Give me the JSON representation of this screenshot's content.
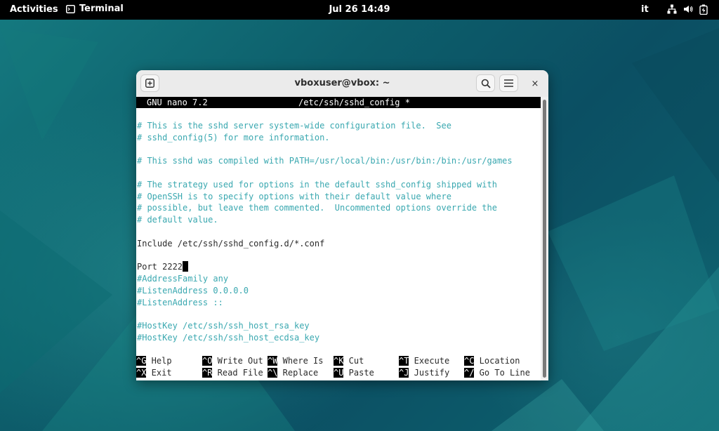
{
  "topbar": {
    "activities": "Activities",
    "app_name": "Terminal",
    "clock": "Jul 26  14:49",
    "language": "it",
    "icons": [
      "network-icon",
      "volume-icon",
      "battery-icon"
    ]
  },
  "window": {
    "title": "vboxuser@vbox: ~",
    "new_tab_icon": "new-tab-icon",
    "search_icon": "search-icon",
    "menu_icon": "hamburger-menu-icon",
    "close_label": "×"
  },
  "nano": {
    "version": "GNU nano 7.2",
    "filename": "/etc/ssh/sshd_config *",
    "lines": [
      {
        "text": "",
        "type": "normal"
      },
      {
        "text": "# This is the sshd server system-wide configuration file.  See",
        "type": "comment"
      },
      {
        "text": "# sshd_config(5) for more information.",
        "type": "comment"
      },
      {
        "text": "",
        "type": "normal"
      },
      {
        "text": "# This sshd was compiled with PATH=/usr/local/bin:/usr/bin:/bin:/usr/games",
        "type": "comment"
      },
      {
        "text": "",
        "type": "normal"
      },
      {
        "text": "# The strategy used for options in the default sshd_config shipped with",
        "type": "comment"
      },
      {
        "text": "# OpenSSH is to specify options with their default value where",
        "type": "comment"
      },
      {
        "text": "# possible, but leave them commented.  Uncommented options override the",
        "type": "comment"
      },
      {
        "text": "# default value.",
        "type": "comment"
      },
      {
        "text": "",
        "type": "normal"
      },
      {
        "text": "Include /etc/ssh/sshd_config.d/*.conf",
        "type": "normal"
      },
      {
        "text": "",
        "type": "normal"
      },
      {
        "text": "Port 2222",
        "type": "normal",
        "cursor": true
      },
      {
        "text": "#AddressFamily any",
        "type": "comment"
      },
      {
        "text": "#ListenAddress 0.0.0.0",
        "type": "comment"
      },
      {
        "text": "#ListenAddress ::",
        "type": "comment"
      },
      {
        "text": "",
        "type": "normal"
      },
      {
        "text": "#HostKey /etc/ssh/ssh_host_rsa_key",
        "type": "comment"
      },
      {
        "text": "#HostKey /etc/ssh/ssh_host_ecdsa_key",
        "type": "comment"
      }
    ],
    "shortcuts": [
      [
        {
          "key": "^G",
          "label": "Help"
        },
        {
          "key": "^O",
          "label": "Write Out"
        },
        {
          "key": "^W",
          "label": "Where Is"
        },
        {
          "key": "^K",
          "label": "Cut"
        },
        {
          "key": "^T",
          "label": "Execute"
        },
        {
          "key": "^C",
          "label": "Location"
        }
      ],
      [
        {
          "key": "^X",
          "label": "Exit"
        },
        {
          "key": "^R",
          "label": "Read File"
        },
        {
          "key": "^\\",
          "label": "Replace"
        },
        {
          "key": "^U",
          "label": "Paste"
        },
        {
          "key": "^J",
          "label": "Justify"
        },
        {
          "key": "^/",
          "label": "Go To Line"
        }
      ]
    ]
  },
  "colors": {
    "comment": "#3aa8b0",
    "text": "#2a2a2a",
    "desktop": "#0f5a66"
  }
}
